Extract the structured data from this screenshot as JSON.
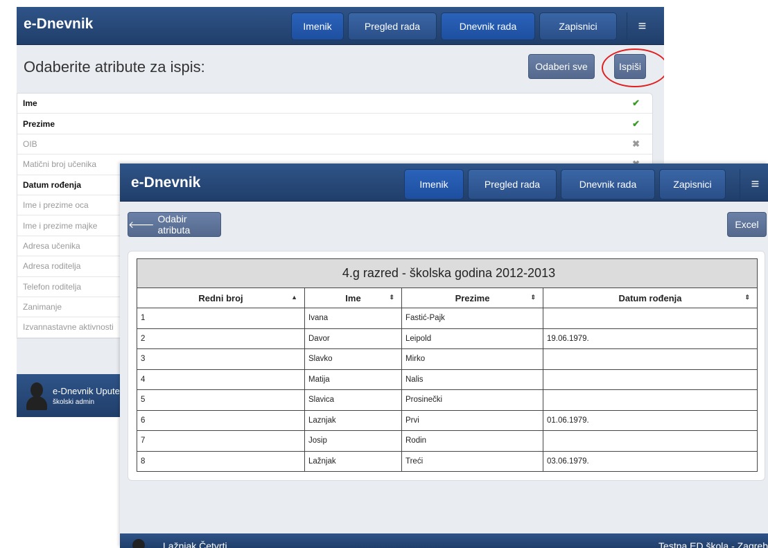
{
  "win1": {
    "brand": "e-Dnevnik",
    "nav": [
      "Imenik",
      "Pregled rada",
      "Dnevnik rada",
      "Zapisnici"
    ],
    "title": "Odaberite atribute za ispis:",
    "select_all": "Odaberi sve",
    "print": "Ispiši",
    "attributes": [
      {
        "label": "Ime",
        "selected": true
      },
      {
        "label": "Prezime",
        "selected": true
      },
      {
        "label": "OIB",
        "selected": false
      },
      {
        "label": "Matični broj učenika",
        "selected": false
      },
      {
        "label": "Datum rođenja",
        "selected": true
      },
      {
        "label": "Ime i prezime oca",
        "selected": false
      },
      {
        "label": "Ime i prezime majke",
        "selected": false
      },
      {
        "label": "Adresa učenika",
        "selected": false
      },
      {
        "label": "Adresa roditelja",
        "selected": false
      },
      {
        "label": "Telefon roditelja",
        "selected": false
      },
      {
        "label": "Zanimanje",
        "selected": false
      },
      {
        "label": "Izvannastavne aktivnosti",
        "selected": false
      }
    ],
    "footer_name": "e-Dnevnik Upute",
    "footer_role": "školski admin"
  },
  "win2": {
    "brand": "e-Dnevnik",
    "nav": [
      "Imenik",
      "Pregled rada",
      "Dnevnik rada",
      "Zapisnici"
    ],
    "back": "Odabir atributa",
    "excel": "Excel",
    "table_caption": "4.g razred - školska godina 2012-2013",
    "columns": [
      "Redni broj",
      "Ime",
      "Prezime",
      "Datum rođenja"
    ],
    "rows": [
      [
        "1",
        "Ivana",
        "Fastić-Pajk",
        ""
      ],
      [
        "2",
        "Davor",
        "Leipold",
        "19.06.1979."
      ],
      [
        "3",
        "Slavko",
        "Mirko",
        ""
      ],
      [
        "4",
        "Matija",
        "Nalis",
        ""
      ],
      [
        "5",
        "Slavica",
        "Prosinečki",
        ""
      ],
      [
        "6",
        "Laznjak",
        "Prvi",
        "01.06.1979."
      ],
      [
        "7",
        "Josip",
        "Rodin",
        ""
      ],
      [
        "8",
        "Lažnjak",
        "Treći",
        "03.06.1979."
      ]
    ],
    "footer_name": "Lažnjak Četvrti",
    "footer_school": "Testna ED škola - Zagreb"
  },
  "colors": {
    "nav": "#2a4a7a",
    "check": "#3a9a2a",
    "annotation": "#e02020"
  },
  "icons": {
    "check": "check-icon",
    "cross": "cross-icon",
    "menu": "hamburger-icon",
    "back": "arrow-left-icon"
  }
}
